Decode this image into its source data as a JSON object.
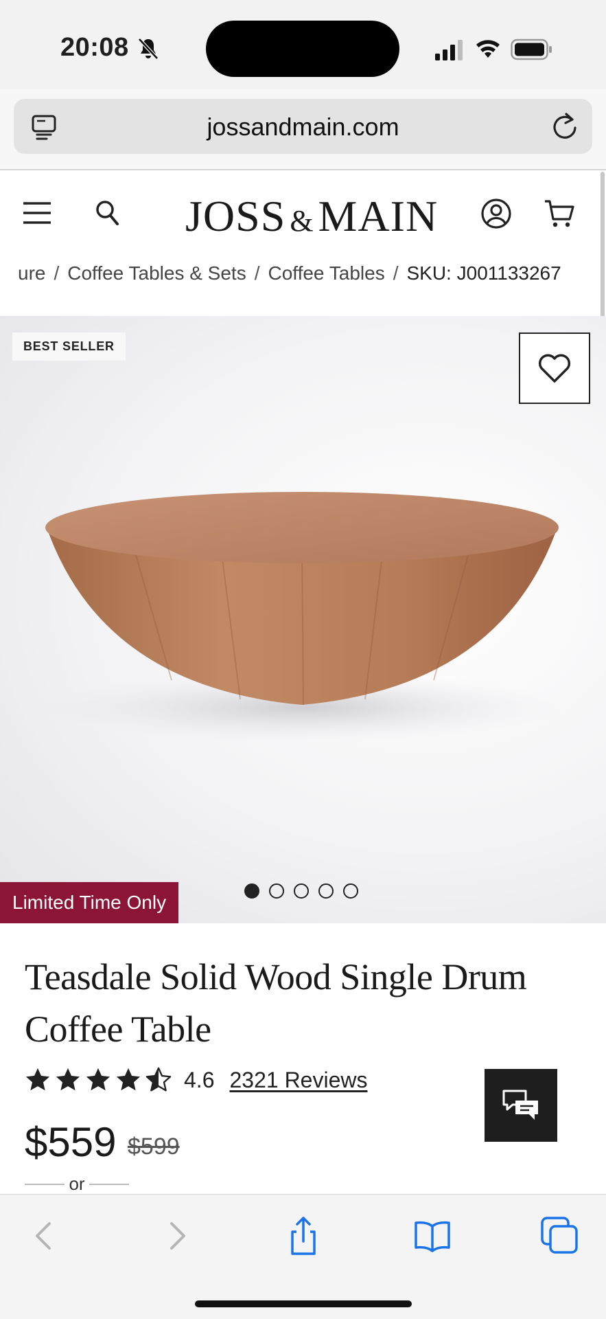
{
  "status": {
    "time": "20:08"
  },
  "browser": {
    "url": "jossandmain.com"
  },
  "header": {
    "logo_left": "JOSS",
    "logo_amp": "&",
    "logo_right": "MAIN"
  },
  "breadcrumb": [
    {
      "label": "ure"
    },
    {
      "label": "Coffee Tables & Sets"
    },
    {
      "label": "Coffee Tables"
    },
    {
      "label": "SKU: J001133267"
    }
  ],
  "breadcrumb_sep": "/",
  "product": {
    "badge": "BEST SELLER",
    "promo": "Limited Time Only",
    "title": "Teasdale Solid Wood Single Drum Coffee Table",
    "rating": "4.6",
    "stars_value": 4.5,
    "reviews": "2321 Reviews",
    "price": "$559",
    "was_price": "$599",
    "or_label": "or",
    "image_count": 5,
    "active_image": 1
  },
  "colors": {
    "promo": "#8c1436",
    "accent_ios": "#1a73e8",
    "chat_bg": "#1e1e1e"
  },
  "icons": [
    "bell-slash-icon",
    "signal-icon",
    "wifi-icon",
    "battery-icon",
    "tabs-icon",
    "reload-icon",
    "menu-icon",
    "search-icon",
    "account-icon",
    "cart-icon",
    "heart-icon",
    "star-icon",
    "chat-icon",
    "back-icon",
    "forward-icon",
    "share-icon",
    "bookmarks-icon",
    "tabs-overview-icon"
  ]
}
